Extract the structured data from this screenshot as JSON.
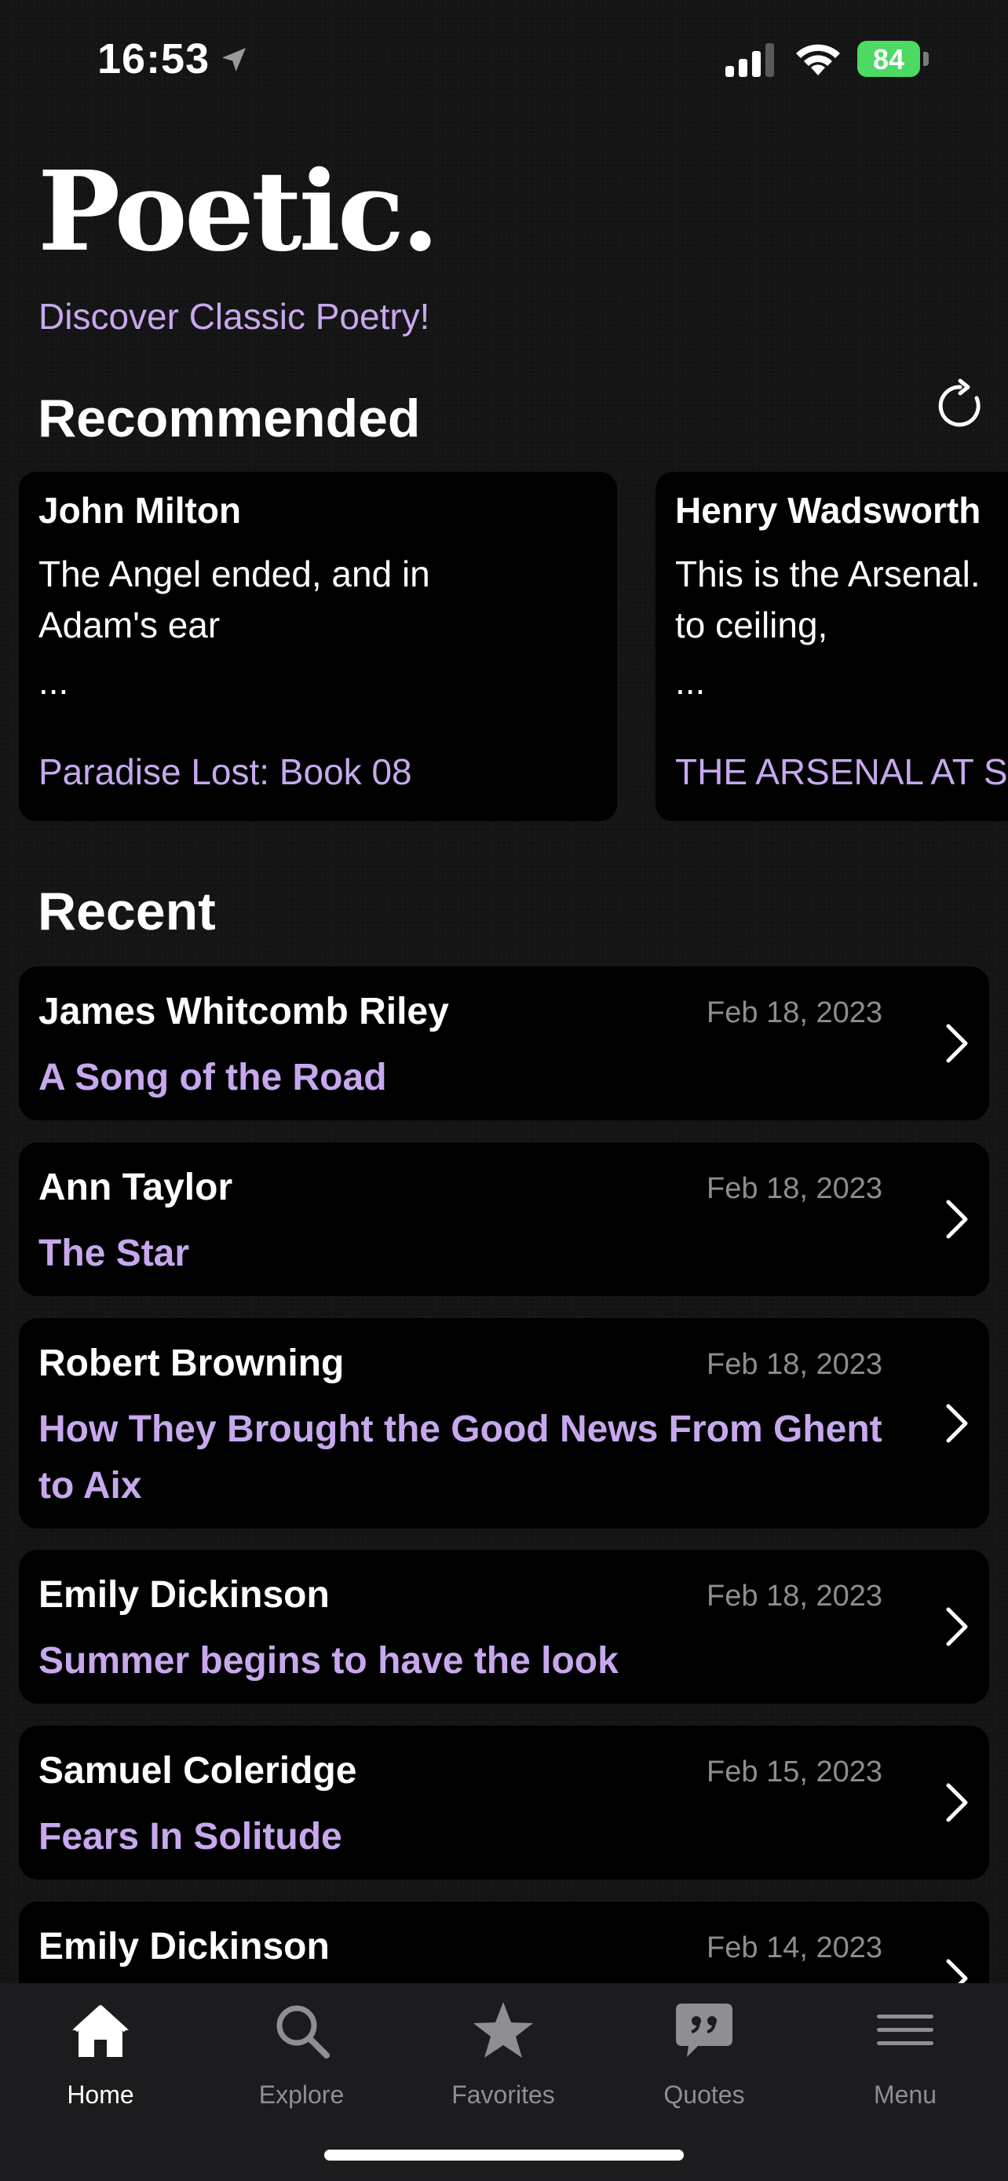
{
  "status": {
    "time": "16:53",
    "battery": "84"
  },
  "header": {
    "title": "Poetic.",
    "subtitle": "Discover Classic Poetry!"
  },
  "recommended": {
    "heading": "Recommended",
    "cards": [
      {
        "author": "John Milton",
        "line1": "The Angel ended, and in",
        "line2": "Adam's ear",
        "ellipsis": "...",
        "poem": "Paradise Lost: Book 08"
      },
      {
        "author": "Henry Wadsworth",
        "line1": "This is the Arsenal.",
        "line2": "to ceiling,",
        "ellipsis": "...",
        "poem": "THE ARSENAL AT S"
      }
    ]
  },
  "recent": {
    "heading": "Recent",
    "items": [
      {
        "author": "James Whitcomb Riley",
        "date": "Feb 18, 2023",
        "title": "A Song of the Road"
      },
      {
        "author": "Ann Taylor",
        "date": "Feb 18, 2023",
        "title": "The Star"
      },
      {
        "author": "Robert Browning",
        "date": "Feb 18, 2023",
        "title": "How They Brought the Good News From Ghent to Aix"
      },
      {
        "author": "Emily Dickinson",
        "date": "Feb 18, 2023",
        "title": "Summer begins to have the look"
      },
      {
        "author": "Samuel Coleridge",
        "date": "Feb 15, 2023",
        "title": "Fears In Solitude"
      },
      {
        "author": "Emily Dickinson",
        "date": "Feb 14, 2023",
        "title": ""
      }
    ]
  },
  "tabs": [
    {
      "label": "Home",
      "icon": "house-icon",
      "active": true
    },
    {
      "label": "Explore",
      "icon": "search-icon",
      "active": false
    },
    {
      "label": "Favorites",
      "icon": "star-icon",
      "active": false
    },
    {
      "label": "Quotes",
      "icon": "quote-bubble-icon",
      "active": false
    },
    {
      "label": "Menu",
      "icon": "menu-icon",
      "active": false
    }
  ],
  "colors": {
    "accent": "#c7a8ee",
    "background": "#141414",
    "card": "#000000",
    "battery": "#4cd964"
  }
}
